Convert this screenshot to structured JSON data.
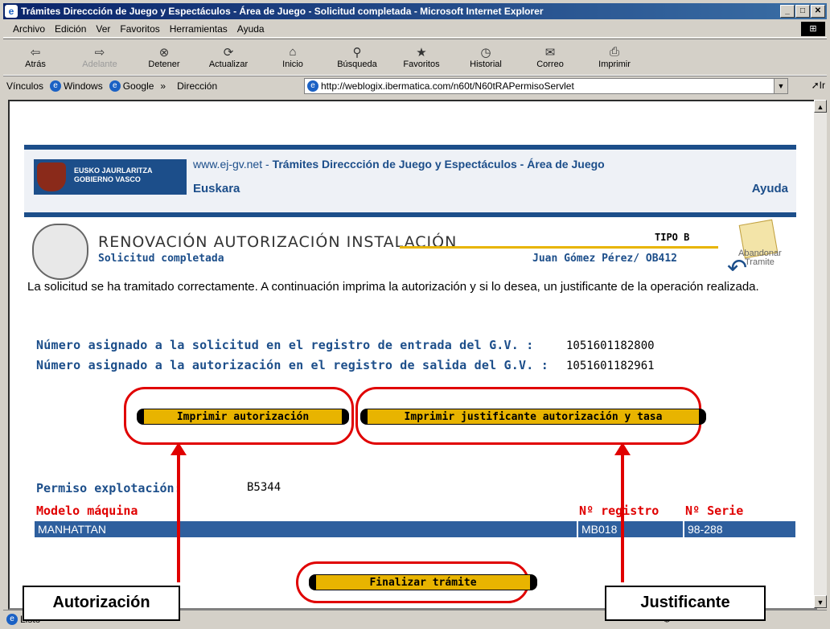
{
  "window": {
    "title": "Trámites Direccción de Juego y Espectáculos - Área de Juego - Solicitud completada - Microsoft Internet Explorer"
  },
  "menu": [
    "Archivo",
    "Edición",
    "Ver",
    "Favoritos",
    "Herramientas",
    "Ayuda"
  ],
  "toolbar": {
    "back": "Atrás",
    "forward": "Adelante",
    "stop": "Detener",
    "refresh": "Actualizar",
    "home": "Inicio",
    "search": "Búsqueda",
    "favorites": "Favoritos",
    "history": "Historial",
    "mail": "Correo",
    "print": "Imprimir"
  },
  "links": {
    "label": "Vínculos",
    "windows": "Windows",
    "google": "Google",
    "more": "»"
  },
  "address": {
    "label": "Dirección",
    "url": "http://weblogix.ibermatica.com/n60t/N60tRAPermisoServlet",
    "go": "Ir"
  },
  "status": {
    "text": "Listo",
    "zone": "Internet"
  },
  "header": {
    "logo_line1": "EUSKO JAURLARITZA",
    "logo_line2": "GOBIERNO VASCO",
    "site": "www.ej-gv.net",
    "section": "Trámites Direccción de Juego y Espectáculos - Área de Juego",
    "language": "Euskara",
    "help": "Ayuda"
  },
  "form": {
    "title": "RENOVACIÓN AUTORIZACIÓN INSTALACIÓN",
    "subtitle": "Solicitud completada",
    "type": "TIPO B",
    "user": "Juan Gómez Pérez/ OB412",
    "abandon_l1": "Abandonar",
    "abandon_l2": "Tramite",
    "intro": "La solicitud se ha tramitado correctamente. A continuación imprima la autorización y si lo desea, un justificante de la operación realizada.",
    "entry_label": "Número asignado a la solicitud en el registro de entrada del G.V. :",
    "entry_value": "1051601182800",
    "exit_label": "Número asignado a la autorización en el registro de salida del G.V. :",
    "exit_value": "1051601182961",
    "btn_print_auth": "Imprimir autorización",
    "btn_print_receipt": "Imprimir justificante autorización y tasa",
    "permit_label": "Permiso explotación:",
    "permit_value": "B5344",
    "col_model": "Modelo máquina",
    "col_reg": "Nº registro",
    "col_serie": "Nº Serie",
    "row_model": "MANHATTAN",
    "row_reg": "MB018",
    "row_serie": "98-288",
    "btn_finish": "Finalizar trámite"
  },
  "callouts": {
    "left": "Autorización",
    "right": "Justificante"
  }
}
